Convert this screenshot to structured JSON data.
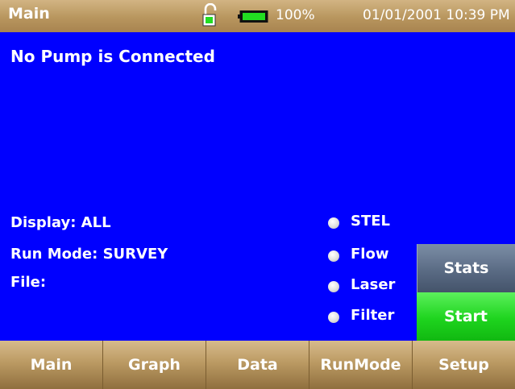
{
  "header": {
    "title": "Main",
    "battery_percent": "100%",
    "battery_level": 1.0,
    "datetime": "01/01/2001 10:39 PM",
    "lock_icon": "unlocked-padlock-icon",
    "battery_icon": "battery-full-icon"
  },
  "status_message": "No Pump is Connected",
  "info": {
    "display": "Display: ALL",
    "run_mode": "Run Mode: SURVEY",
    "file": "File:"
  },
  "indicators": [
    {
      "label": "STEL"
    },
    {
      "label": "Flow"
    },
    {
      "label": "Laser"
    },
    {
      "label": "Filter"
    }
  ],
  "side_buttons": {
    "stats": "Stats",
    "start": "Start"
  },
  "nav": [
    {
      "label": "Main"
    },
    {
      "label": "Graph"
    },
    {
      "label": "Data"
    },
    {
      "label": "RunMode"
    },
    {
      "label": "Setup"
    }
  ],
  "colors": {
    "screen_background": "#0000ff",
    "header": "#c0a06c",
    "start_button": "#1ed41e",
    "stats_button": "#5a6b84",
    "battery_fill": "#22dd22"
  }
}
